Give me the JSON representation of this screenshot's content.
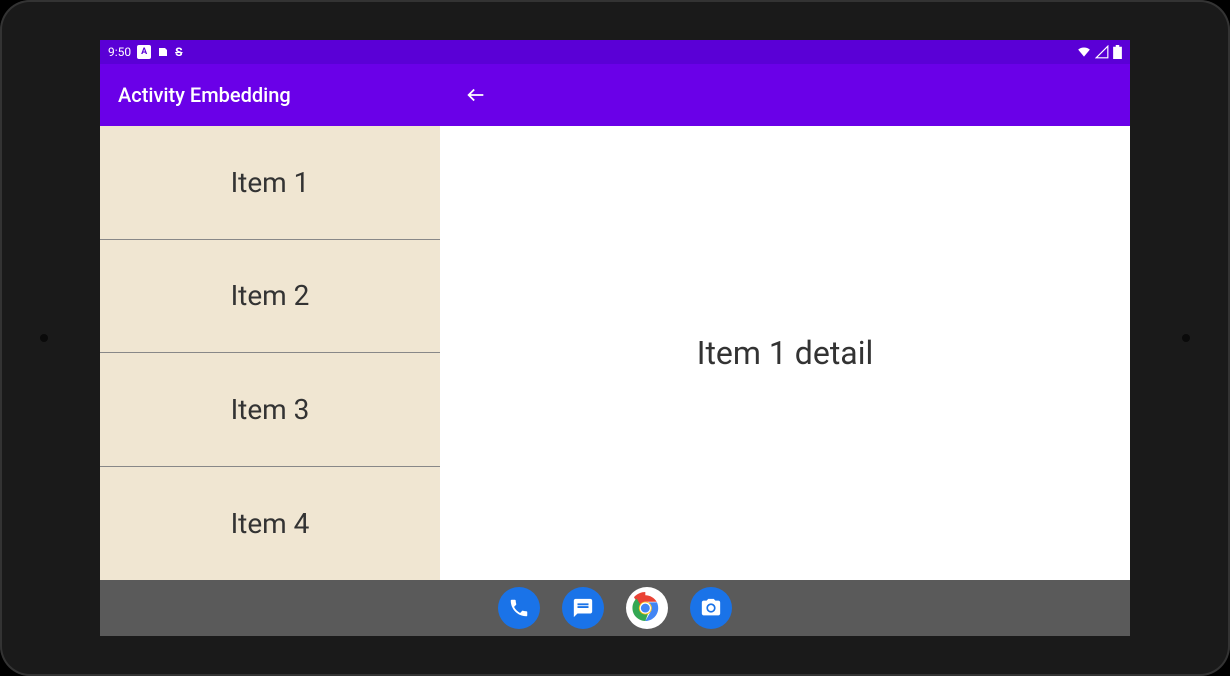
{
  "status_bar": {
    "time": "9:50",
    "badge_a": "A",
    "badge_s": "S"
  },
  "app_bar": {
    "title": "Activity Embedding"
  },
  "list": {
    "items": [
      {
        "label": "Item 1"
      },
      {
        "label": "Item 2"
      },
      {
        "label": "Item 3"
      },
      {
        "label": "Item 4"
      }
    ]
  },
  "detail": {
    "text": "Item 1 detail"
  }
}
